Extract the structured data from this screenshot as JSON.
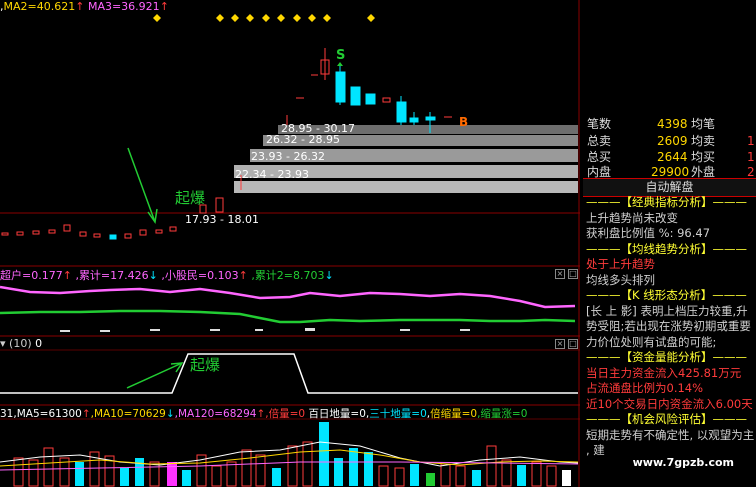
{
  "top_legend": {
    "ma2": "MA2=40.621",
    "ma3": "MA3=36.921",
    "arrow_up": "↑",
    "prefix": ","
  },
  "signals": {
    "buy": "S",
    "b": "B"
  },
  "chips": [
    "28.95 - 30.17",
    "26.32 - 28.95",
    "23.93 - 26.32",
    "22.34 - 23.93",
    "17.93 - 18.01"
  ],
  "annotations": {
    "qibao1": "起爆",
    "qibao2": "起爆"
  },
  "indicator1": {
    "chaohu": "超户=0.177",
    "leiji": "累计=17.426",
    "xiaogumin": "小股民=0.103",
    "leiji2": "累计2=8.703",
    "up": "↑",
    "down": "↓"
  },
  "indicator2": {
    "param": "(10)",
    "value": "0"
  },
  "volume_legend": {
    "first": "31",
    "ma5": "MA5=61300",
    "ma10": "MA10=70629",
    "ma120": "MA120=68294",
    "beiliang": "倍量=0",
    "bairidi": "百日地量=0",
    "sanshi": "三十地量=0",
    "beisuo": "倍缩量=0",
    "suoliang": "缩量涨=0",
    "up": "↑",
    "down": "↓"
  },
  "stats": [
    {
      "label": "笔数",
      "value": "4398",
      "label2": "均笔",
      "value2": ""
    },
    {
      "label": "总卖",
      "value": "2609",
      "label2": "均卖",
      "value2": "1"
    },
    {
      "label": "总买",
      "value": "2644",
      "label2": "均买",
      "value2": "1"
    },
    {
      "label": "内盘",
      "value": "29900",
      "label2": "外盘",
      "value2": "2"
    }
  ],
  "auto_title": "自动解盘",
  "analysis": [
    {
      "cls": "sec",
      "text": "———【经典指标分析】———"
    },
    {
      "cls": "txt",
      "text": "上升趋势尚未改变"
    },
    {
      "cls": "txt",
      "text": "获利盘比例值 %: 96.47"
    },
    {
      "cls": "sec",
      "text": "———【均线趋势分析】———"
    },
    {
      "cls": "red",
      "text": "处于上升趋势"
    },
    {
      "cls": "txt",
      "text": "均线多头排列"
    },
    {
      "cls": "sec",
      "text": "———【K 线形态分析】———"
    },
    {
      "cls": "txt",
      "text": "[长 上 影] 表明上档压力较重,升"
    },
    {
      "cls": "txt",
      "text": "势受阻;若出现在涨势初期或重要"
    },
    {
      "cls": "txt",
      "text": "力价位处则有试盘的可能;"
    },
    {
      "cls": "sec",
      "text": "———【资金量能分析】———"
    },
    {
      "cls": "red",
      "text": "当日主力资金流入425.81万元"
    },
    {
      "cls": "red",
      "text": "占流通盘比例为0.14%"
    },
    {
      "cls": "red",
      "text": "近10个交易日内资金流入6.00天"
    },
    {
      "cls": "sec",
      "text": "———【机会风险评估】———"
    },
    {
      "cls": "txt",
      "text": "短期走势有不确定性, 以观望为主"
    },
    {
      "cls": "txt",
      "text": ", 建"
    }
  ],
  "watermark": "www.7gpzb.com",
  "colors": {
    "red": "#ff3b3b",
    "cyan": "#00e5ff",
    "yellow": "#ffd700",
    "magenta": "#ff66ff",
    "green": "#22cc33",
    "white": "#ffffff"
  }
}
